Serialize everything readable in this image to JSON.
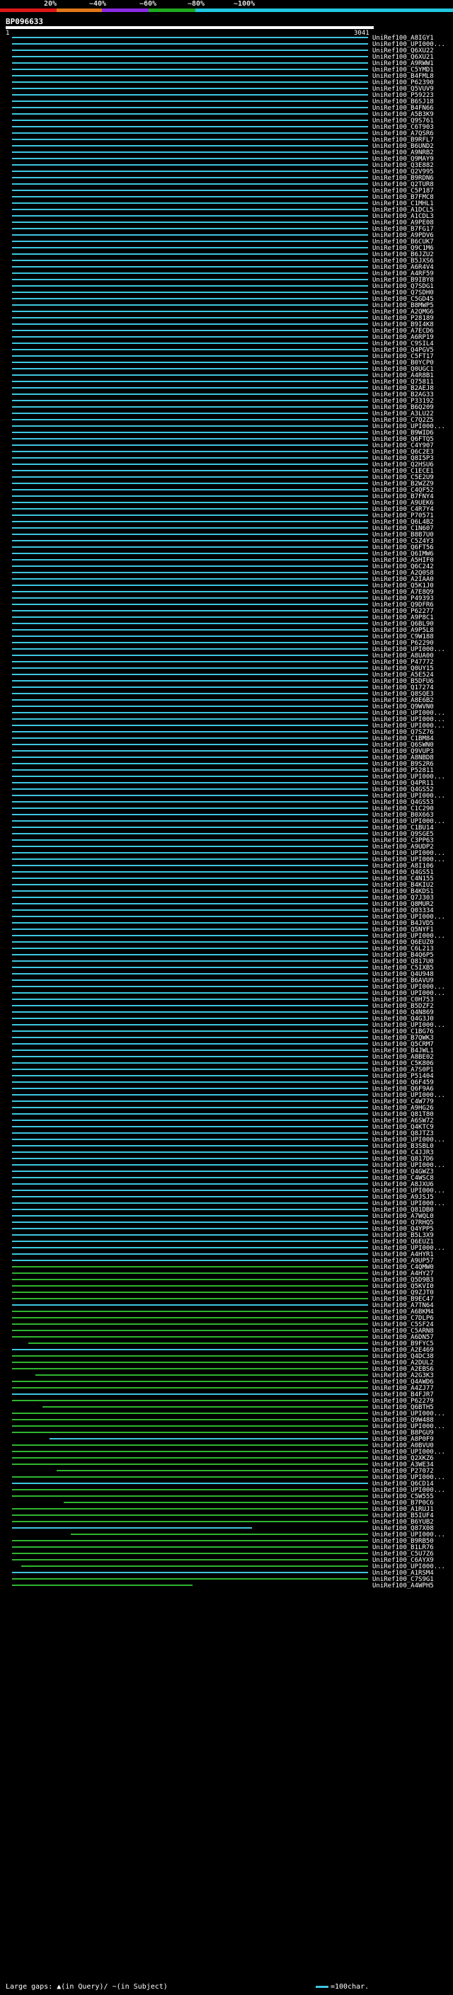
{
  "scale": {
    "ticks": [
      "20%",
      "~40%",
      "~60%",
      "~80%",
      "~100%"
    ],
    "colors": [
      "#e01818",
      "#e07818",
      "#8a2be2",
      "#1fa81f",
      "#22c8e0"
    ]
  },
  "query": {
    "name": "BP096633",
    "start": "1",
    "end": "3041"
  },
  "hits": [
    "UniRef100_A8IGY1",
    "UniRef100_UPI000...",
    "UniRef100_Q6XU22",
    "UniRef100_Q6XU21",
    "UniRef100_A9RWW1",
    "UniRef100_C5YMD1",
    "UniRef100_B4FML8",
    "UniRef100_P62390",
    "UniRef100_Q5VUV9",
    "UniRef100_P59223",
    "UniRef100_B6SJ18",
    "UniRef100_B4FN66",
    "UniRef100_A5B3K9",
    "UniRef100_Q9S761",
    "UniRef100_C6T903",
    "UniRef100_A7QSR6",
    "UniRef100_B9RFL7",
    "UniRef100_B6UND2",
    "UniRef100_A9NRB2",
    "UniRef100_Q9MAY9",
    "UniRef100_Q3E882",
    "UniRef100_Q2V995",
    "UniRef100_B9RDN6",
    "UniRef100_Q2TUR8",
    "UniRef100_C5P187",
    "UniRef100_B7FMC8",
    "UniRef100_C1MHL1",
    "UniRef100_A1DCL5",
    "UniRef100_A1CDL3",
    "UniRef100_A9PE08",
    "UniRef100_B7FG17",
    "UniRef100_A9PDV6",
    "UniRef100_B6CUK7",
    "UniRef100_Q9C1M6",
    "UniRef100_B6JZU2",
    "UniRef100_B5JXS6",
    "UniRef100_A6R4V4",
    "UniRef100_A4RF59",
    "UniRef100_B9IBY8",
    "UniRef100_Q7SDG1",
    "UniRef100_Q7SDH0",
    "UniRef100_C5GD45",
    "UniRef100_B8MWP5",
    "UniRef100_A2QMG6",
    "UniRef100_P28189",
    "UniRef100_B9I4K8",
    "UniRef100_A7ECD6",
    "UniRef100_A6RP19",
    "UniRef100_C9SIL4",
    "UniRef100_Q4PGV5",
    "UniRef100_C5FT17",
    "UniRef100_B0YCP0",
    "UniRef100_Q0UGC1",
    "UniRef100_A4R8B1",
    "UniRef100_Q75811",
    "UniRef100_B2AEJ8",
    "UniRef100_B2AG33",
    "UniRef100_P33192",
    "UniRef100_B6Q209",
    "UniRef100_A3LU22",
    "UniRef100_C7Q2Z5",
    "UniRef100_UPI000...",
    "UniRef100_B9WID6",
    "UniRef100_Q6FTQ5",
    "UniRef100_C4Y907",
    "UniRef100_Q6C2E3",
    "UniRef100_Q8I5P3",
    "UniRef100_Q2HSU6",
    "UniRef100_C1ECE1",
    "UniRef100_C5E2U9",
    "UniRef100_B2WZZ9",
    "UniRef100_C4QF52",
    "UniRef100_B7FNY4",
    "UniRef100_A9UEK6",
    "UniRef100_C4R7Y4",
    "UniRef100_P70571",
    "UniRef100_Q6L4B2",
    "UniRef100_C1N607",
    "UniRef100_B8B7U0",
    "UniRef100_C5Z4Y3",
    "UniRef100_Q6FT56",
    "UniRef100_Q6IMW6",
    "UniRef100_A5HIF0",
    "UniRef100_Q6C242",
    "UniRef100_A2Q0S8",
    "UniRef100_A2IAA0",
    "UniRef100_Q5K1J0",
    "UniRef100_A7E8Q9",
    "UniRef100_P49393",
    "UniRef100_Q9DFR6",
    "UniRef100_P62277",
    "UniRef100_A9P8C1",
    "UniRef100_Q6BL90",
    "UniRef100_A9P5L8",
    "UniRef100_C9W188",
    "UniRef100_P62290",
    "UniRef100_UPI000...",
    "UniRef100_A8UA00",
    "UniRef100_P47772",
    "UniRef100_Q0UY15",
    "UniRef100_A5E524",
    "UniRef100_B5DFU6",
    "UniRef100_Q17274",
    "UniRef100_Q8SQE3",
    "UniRef100_A8E6B2",
    "UniRef100_Q9WVN0",
    "UniRef100_UPI000...",
    "UniRef100_UPI000...",
    "UniRef100_UPI000...",
    "UniRef100_Q7SZ76",
    "UniRef100_C1BM84",
    "UniRef100_Q6SWN0",
    "UniRef100_Q9VUP3",
    "UniRef100_A8NBD8",
    "UniRef100_B9S2R6",
    "UniRef100_P52811",
    "UniRef100_UPI000...",
    "UniRef100_Q4PR11",
    "UniRef100_Q4GS52",
    "UniRef100_UPI000...",
    "UniRef100_Q4GS53",
    "UniRef100_C1C290",
    "UniRef100_B0X663",
    "UniRef100_UPI000...",
    "UniRef100_C1BU14",
    "UniRef100_Q9SGE5",
    "UniRef100_C3PP63",
    "UniRef100_A9UDP2",
    "UniRef100_UPI000...",
    "UniRef100_UPI000...",
    "UniRef100_A8I106",
    "UniRef100_Q4GS51",
    "UniRef100_C4N155",
    "UniRef100_B4KIU2",
    "UniRef100_B4KDS1",
    "UniRef100_Q7J303",
    "UniRef100_Q8MUR2",
    "UniRef100_Q03334",
    "UniRef100_UPI000...",
    "UniRef100_B4JVD5",
    "UniRef100_Q5NYF1",
    "UniRef100_UPI000...",
    "UniRef100_Q6EUZ0",
    "UniRef100_C6L213",
    "UniRef100_B4Q6P5",
    "UniRef100_Q817U0",
    "UniRef100_C5IXB5",
    "UniRef100_Q4U948",
    "UniRef100_B6AVU9",
    "UniRef100_UPI000...",
    "UniRef100_UPI000...",
    "UniRef100_C0H753",
    "UniRef100_B5DZF2",
    "UniRef100_Q4N869",
    "UniRef100_Q4G3J0",
    "UniRef100_UPI000...",
    "UniRef100_C1BG76",
    "UniRef100_B7QWK3",
    "UniRef100_Q5CRM7",
    "UniRef100_B4JWL1",
    "UniRef100_A8BE02",
    "UniRef100_C5K806",
    "UniRef100_A7S0P1",
    "UniRef100_P51404",
    "UniRef100_Q6F459",
    "UniRef100_Q6F9A6",
    "UniRef100_UPI000...",
    "UniRef100_C4W779",
    "UniRef100_A9HG26",
    "UniRef100_Q81T80",
    "UniRef100_A6SW72",
    "UniRef100_Q4KTC9",
    "UniRef100_Q8JTZ3",
    "UniRef100_UPI000...",
    "UniRef100_B3SBL0",
    "UniRef100_C4JJR3",
    "UniRef100_Q817D6",
    "UniRef100_UPI000...",
    "UniRef100_Q4GWZ3",
    "UniRef100_C4WSC8",
    "UniRef100_A8JXU6",
    "UniRef100_UPI000...",
    "UniRef100_A9JSJ5",
    "UniRef100_UPI000...",
    "UniRef100_Q81DB0",
    "UniRef100_A7WQL0",
    "UniRef100_Q7RHQ5",
    "UniRef100_Q4YPP5",
    "UniRef100_B5L3X9",
    "UniRef100_Q6EUZ1",
    "UniRef100_UPI000...",
    "UniRef100_A4HYR1",
    "UniRef100_A9UP57",
    "UniRef100_C4QMW0",
    "UniRef100_A4HY27",
    "UniRef100_Q5D9B3",
    "UniRef100_Q5KVI0",
    "UniRef100_Q9ZJT0",
    "UniRef100_B9EC47",
    "UniRef100_A7TN64",
    "UniRef100_A6BKM4",
    "UniRef100_C7DLP6",
    "UniRef100_C5SF24",
    "UniRef100_C5ARN8",
    "UniRef100_A6DN57",
    "UniRef100_B9FYC5",
    "UniRef100_A2E469",
    "UniRef100_Q4DC38",
    "UniRef100_A2DUL2",
    "UniRef100_A2EBS6",
    "UniRef100_A2G3K3",
    "UniRef100_Q4AWD6",
    "UniRef100_A4ZJ77",
    "UniRef100_B4FJR7",
    "UniRef100_P62279",
    "UniRef100_Q6BTH5",
    "UniRef100_UPI000...",
    "UniRef100_Q9W488",
    "UniRef100_UPI000...",
    "UniRef100_B8PGU9",
    "UniRef100_A8P0F9",
    "UniRef100_A0BVU0",
    "UniRef100_UPI000...",
    "UniRef100_Q2XKZ6",
    "UniRef100_A3WE34",
    "UniRef100_P27072",
    "UniRef100_UPI000...",
    "UniRef100_Q6CD14",
    "UniRef100_UPI000...",
    "UniRef100_C5W555",
    "UniRef100_B7P0C6",
    "UniRef100_A1RUJ1",
    "UniRef100_B5IUF4",
    "UniRef100_B6YUB2",
    "UniRef100_Q87X08",
    "UniRef100_UPI000...",
    "UniRef100_B9RB50",
    "UniRef100_B1LR76",
    "UniRef100_C5U7Z6",
    "UniRef100_C6AYX9",
    "UniRef100_UPI000...",
    "UniRef100_A1RSM4",
    "UniRef100_C7S9G1",
    "UniRef100_A4WPH5"
  ],
  "legend": {
    "large_gaps_prefix": "Large gaps:",
    "in_query": "(in Query)/",
    "in_subject": "~(in Subject)",
    "scale_text": "=100char."
  }
}
